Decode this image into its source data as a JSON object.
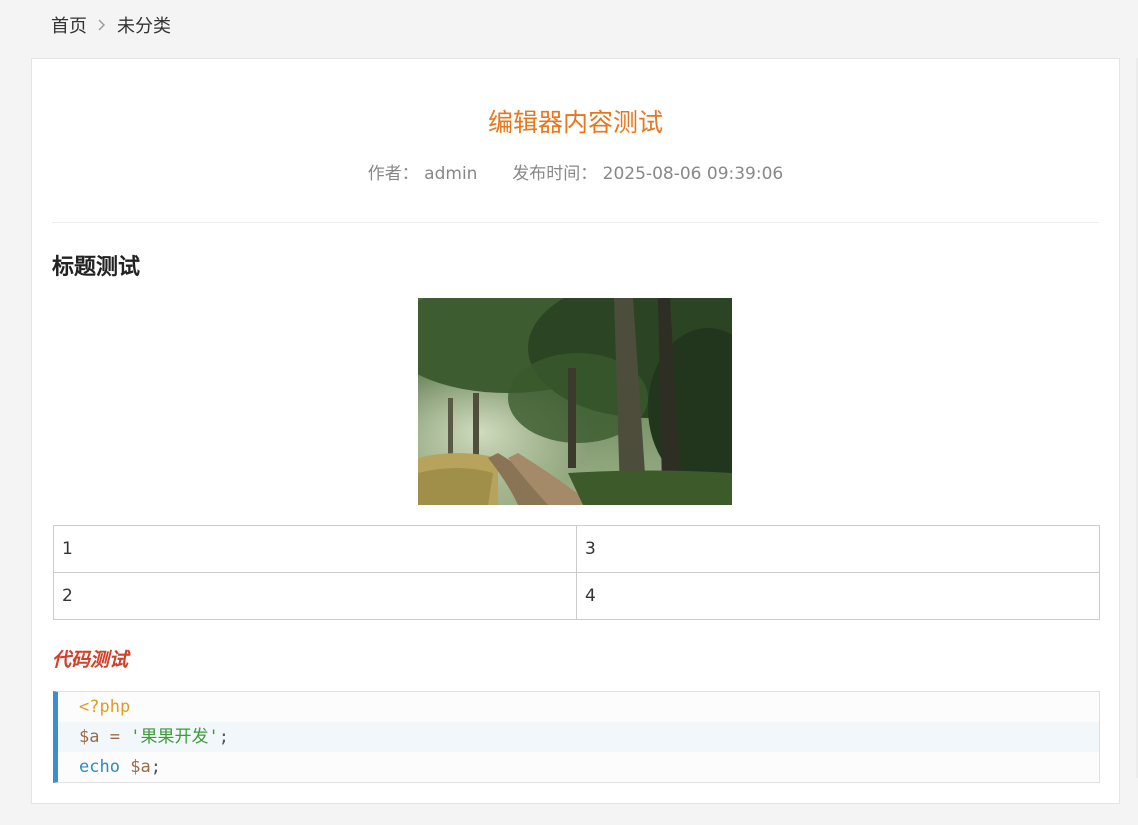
{
  "breadcrumb": {
    "home": "首页",
    "category": "未分类"
  },
  "article": {
    "title": "编辑器内容测试",
    "author_label": "作者：",
    "author": "admin",
    "published_label": "发布时间：",
    "published": "2025-08-06 09:39:06",
    "heading": "标题测试",
    "image_icon": "forest-photo",
    "table": [
      [
        "1",
        "3"
      ],
      [
        "2",
        "4"
      ]
    ],
    "code_heading": "代码测试",
    "code": {
      "line1": {
        "tag": "<?php"
      },
      "line2": {
        "var": "$a",
        "op": " = ",
        "str": "'果果开发'",
        "end": ";"
      },
      "line3": {
        "kw": "echo",
        "sp": " ",
        "var": "$a",
        "end": ";"
      }
    }
  },
  "colors": {
    "title": "#e8771c",
    "code_heading": "#d0402a",
    "code_border": "#3a8fd0"
  }
}
